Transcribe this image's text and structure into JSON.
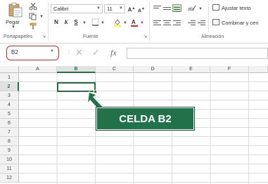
{
  "ribbon": {
    "clipboard": {
      "paste_label": "Pegar",
      "group_label": "Portapapeles"
    },
    "font": {
      "font_name": "Calibri",
      "font_size": "11",
      "bold_label": "N",
      "italic_label": "K",
      "underline_label": "S",
      "grow_label": "A",
      "shrink_label": "A",
      "group_label": "Fuente"
    },
    "alignment": {
      "wrap_text_label": "Ajustar texto",
      "merge_label": "Combinar y cen",
      "group_label": "Alineación"
    }
  },
  "formula_bar": {
    "name_box_value": "B2",
    "cancel_glyph": "✕",
    "enter_glyph": "✓",
    "function_glyph": "fx",
    "formula_value": ""
  },
  "sheet": {
    "columns": [
      "A",
      "B",
      "C",
      "D",
      "E",
      "F"
    ],
    "rows": [
      "1",
      "2",
      "3",
      "4",
      "5",
      "6",
      "7",
      "8",
      "9",
      "10",
      "11",
      "12"
    ],
    "active_column": "B",
    "active_row": "2"
  },
  "callout": {
    "text": "CELDA B2",
    "color": "#21714a"
  },
  "colors": {
    "accent": "#217346",
    "highlight_border": "#d8262d"
  }
}
